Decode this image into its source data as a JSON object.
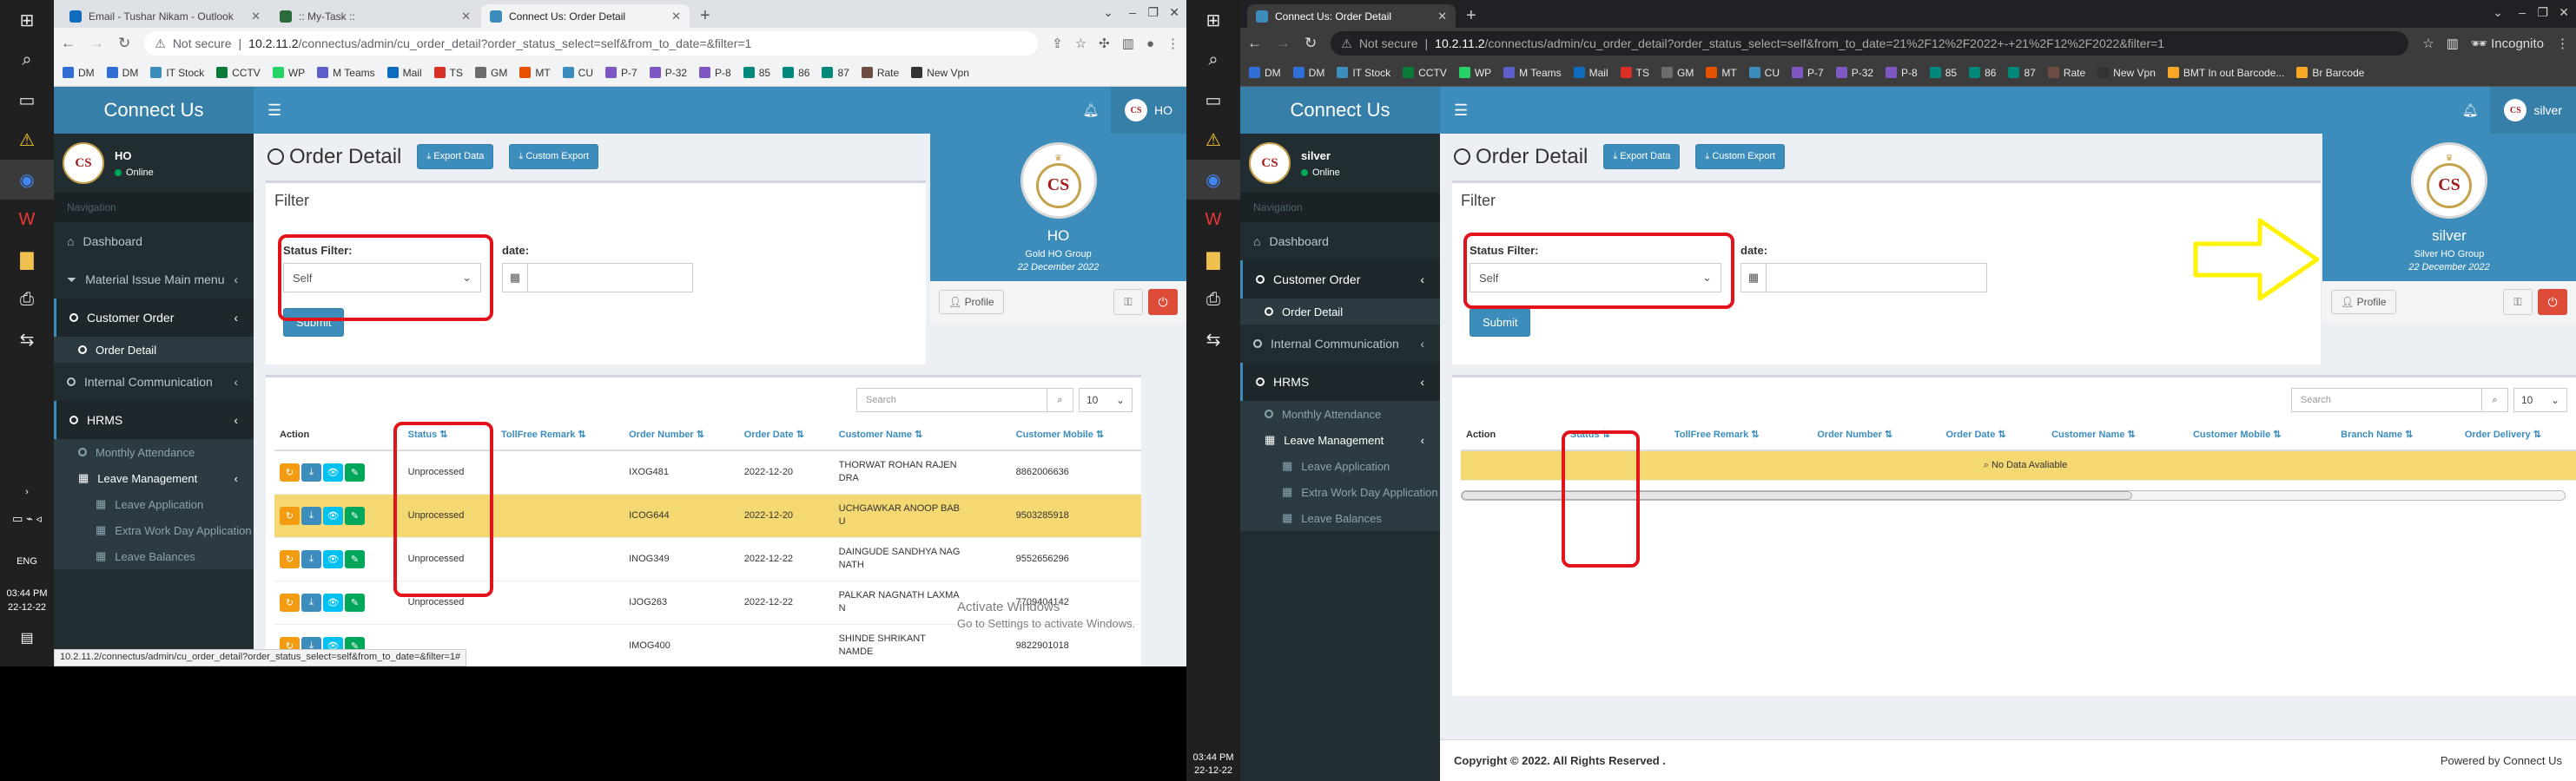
{
  "left": {
    "taskbar": {
      "time": "03:44 PM",
      "date": "22-12-22",
      "lang": "ENG"
    },
    "browser": {
      "tabs": [
        {
          "title": "Email - Tushar Nikam - Outlook",
          "color": "#0f6cbd"
        },
        {
          "title": ":: My-Task ::",
          "color": "#2a6b3c"
        },
        {
          "title": "Connect Us: Order Detail",
          "color": "#3c8dbc"
        }
      ],
      "not_secure": "Not secure",
      "url_domain": "10.2.11.2",
      "url_path": "/connectus/admin/cu_order_detail?order_status_select=self&from_to_date=&filter=1",
      "bookmarks": [
        "DM",
        "DM",
        "IT Stock",
        "CCTV",
        "WP",
        "M Teams",
        "Mail",
        "TS",
        "GM",
        "MT",
        "CU",
        "P-7",
        "P-32",
        "P-8",
        "85",
        "86",
        "87",
        "Rate",
        "New Vpn"
      ],
      "status_url": "10.2.11.2/connectus/admin/cu_order_detail?order_status_select=self&from_to_date=&filter=1#"
    },
    "app": {
      "logo": "Connect Us",
      "user": {
        "name": "HO",
        "status": "Online"
      },
      "top_user": "HO",
      "nav_header": "Navigation",
      "menu": [
        {
          "label": "Dashboard",
          "icon": "dashboard-icon"
        },
        {
          "label": "Material Issue Main menu",
          "icon": "filter-icon"
        },
        {
          "label": "Customer Order",
          "icon": "circle-icon",
          "open": true
        },
        {
          "label": "Internal Communication",
          "icon": "circle-icon"
        },
        {
          "label": "HRMS",
          "icon": "circle-icon",
          "open": true
        }
      ],
      "submenu_order": "Order Detail",
      "hrms_items": [
        "Monthly Attendance",
        "Leave Management"
      ],
      "leave_items": [
        "Leave Application",
        "Extra Work Day Application",
        "Leave Balances"
      ],
      "page_title": "Order Detail",
      "export_data": "Export Data",
      "custom_export": "Custom Export",
      "filter_title": "Filter",
      "status_filter_label": "Status Filter:",
      "status_filter_value": "Self",
      "date_label": "date:",
      "submit": "Submit",
      "search_placeholder": "Search",
      "page_length": "10",
      "columns": [
        "Action",
        "Status",
        "TollFree Remark",
        "Order Number",
        "Order Date",
        "Customer Name",
        "Customer Mobile"
      ],
      "rows": [
        {
          "status": "Unprocessed",
          "remark": "",
          "order": "IXOG481",
          "date": "2022-12-20",
          "name": "THORWAT ROHAN RAJEN DRA",
          "mobile": "8862006636"
        },
        {
          "status": "Unprocessed",
          "remark": "",
          "order": "ICOG644",
          "date": "2022-12-20",
          "name": "UCHGAWKAR ANOOP BAB U",
          "mobile": "9503285918"
        },
        {
          "status": "Unprocessed",
          "remark": "",
          "order": "INOG349",
          "date": "2022-12-22",
          "name": "DAINGUDE SANDHYA NAG NATH",
          "mobile": "9552656296"
        },
        {
          "status": "Unprocessed",
          "remark": "",
          "order": "IJOG263",
          "date": "2022-12-22",
          "name": "PALKAR NAGNATH LAXMA N",
          "mobile": "7709404142"
        },
        {
          "status": "",
          "remark": "",
          "order": "IMOG400",
          "date": "",
          "name": "SHINDE SHRIKANT NAMDE",
          "mobile": "9822901018"
        }
      ],
      "profile": {
        "logo": "CS",
        "name": "HO",
        "group": "Gold HO Group",
        "date": "22 December 2022",
        "profile_btn": "Profile"
      },
      "watermark": [
        "Activate Windows",
        "Go to Settings to activate Windows."
      ]
    }
  },
  "right": {
    "taskbar": {
      "time": "03:44 PM",
      "date": "22-12-22"
    },
    "browser": {
      "tabs": [
        {
          "title": "Connect Us: Order Detail",
          "color": "#3c8dbc"
        }
      ],
      "not_secure": "Not secure",
      "url_domain": "10.2.11.2",
      "url_path": "/connectus/admin/cu_order_detail?order_status_select=self&from_to_date=21%2F12%2F2022+-+21%2F12%2F2022&filter=1",
      "incognito": "Incognito",
      "bookmarks": [
        "DM",
        "DM",
        "IT Stock",
        "CCTV",
        "WP",
        "M Teams",
        "Mail",
        "TS",
        "GM",
        "MT",
        "CU",
        "P-7",
        "P-32",
        "P-8",
        "85",
        "86",
        "87",
        "Rate",
        "New Vpn",
        "BMT In out Barcode...",
        "Br Barcode"
      ]
    },
    "app": {
      "logo": "Connect Us",
      "user": {
        "name": "silver",
        "status": "Online"
      },
      "top_user": "silver",
      "nav_header": "Navigation",
      "menu": [
        {
          "label": "Dashboard",
          "icon": "dashboard-icon"
        },
        {
          "label": "Customer Order",
          "icon": "circle-icon",
          "open": true
        },
        {
          "label": "Internal Communication",
          "icon": "circle-icon"
        },
        {
          "label": "HRMS",
          "icon": "circle-icon",
          "open": true
        }
      ],
      "submenu_order": "Order Detail",
      "hrms_items": [
        "Monthly Attendance",
        "Leave Management"
      ],
      "leave_items": [
        "Leave Application",
        "Extra Work Day Application",
        "Leave Balances"
      ],
      "page_title": "Order Detail",
      "export_data": "Export Data",
      "custom_export": "Custom Export",
      "filter_title": "Filter",
      "status_filter_label": "Status Filter:",
      "status_filter_value": "Self",
      "date_label": "date:",
      "submit": "Submit",
      "search_placeholder": "Search",
      "page_length": "10",
      "columns": [
        "Action",
        "Status",
        "TollFree Remark",
        "Order Number",
        "Order Date",
        "Customer Name",
        "Customer Mobile",
        "Branch Name",
        "Order Delivery"
      ],
      "no_data": "No Data Avaliable",
      "profile": {
        "logo": "CS",
        "name": "silver",
        "group": "Silver HO Group",
        "date": "22 December 2022",
        "profile_btn": "Profile"
      },
      "footer_copy": "Copyright © 2022. All Rights Reserved .",
      "footer_powered": "Powered by Connect Us"
    }
  },
  "colors": {
    "primary": "#3c8dbc",
    "sidebar": "#222d32",
    "highlight": "#f4d871",
    "annotation": "#e3131b",
    "arrow": "#fff200"
  }
}
